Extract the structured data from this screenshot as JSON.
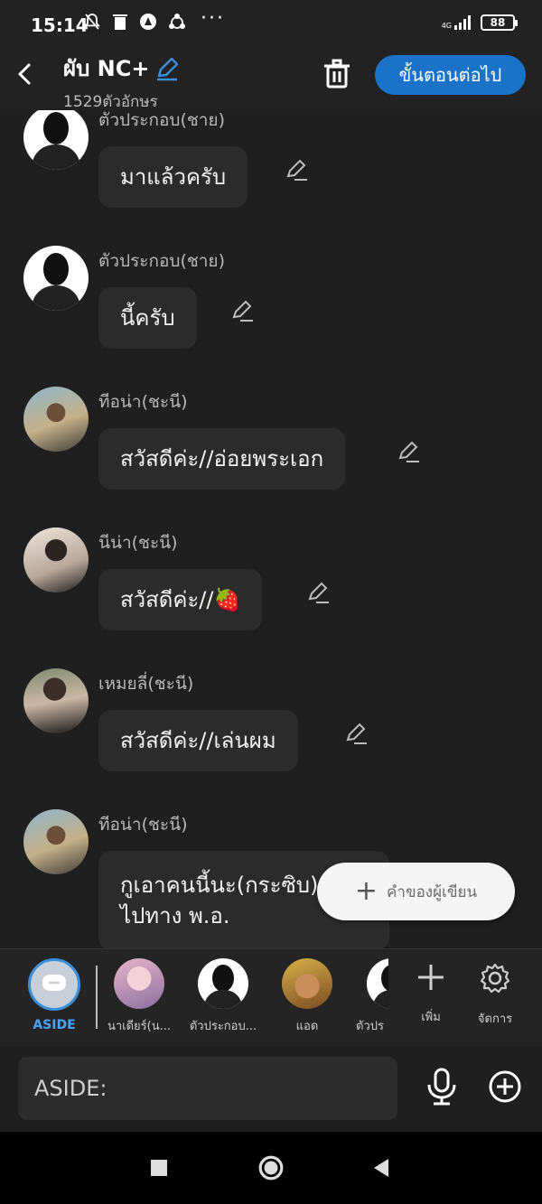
{
  "status_bar": {
    "time": "15:14",
    "network": "4G",
    "battery": "88"
  },
  "header": {
    "title": "ผับ NC+",
    "subtitle": "1529ตัวอักษร",
    "next_label": "ขั้นตอนต่อไป"
  },
  "messages": [
    {
      "sender": "ตัวประกอบ(ชาย)",
      "text": "มาแล้วครับ",
      "avatar": "silhouette"
    },
    {
      "sender": "ตัวประกอบ(ชาย)",
      "text": "นี้ครับ",
      "avatar": "silhouette"
    },
    {
      "sender": "ทีอน่า(ชะนี)",
      "text": "สวัสดีค่ะ//อ่อยพระเอก",
      "avatar": "photo-a"
    },
    {
      "sender": "นีน่า(ชะนี)",
      "text": "สวัสดีค่ะ//🍓",
      "avatar": "photo-b"
    },
    {
      "sender": "เหมยลี่(ชะนี)",
      "text": "สวัสดีค่ะ//เล่นผม",
      "avatar": "photo-c"
    },
    {
      "sender": "ทีอน่า(ชะนี)",
      "text_line1": "กูเอาคนนี้นะ(กระซิบ)",
      "text_line2": "ไปทาง พ.อ.",
      "avatar": "photo-a"
    }
  ],
  "author_button": {
    "label": "คำของผู้เขียน"
  },
  "characters": [
    {
      "label": "ASIDE",
      "active": true
    },
    {
      "label": "นาเดียร์(น..."
    },
    {
      "label": "ตัวประกอบ..."
    },
    {
      "label": "แอด"
    },
    {
      "label": "ตัวปร"
    }
  ],
  "actions": {
    "add_label": "เพิ่ม",
    "manage_label": "จัดการ"
  },
  "input": {
    "placeholder": "ASIDE:"
  },
  "colors": {
    "accent": "#1a73c8",
    "aside_accent": "#4aa3ff",
    "bubble": "#2b2b2b",
    "background": "#1f1f1f"
  }
}
